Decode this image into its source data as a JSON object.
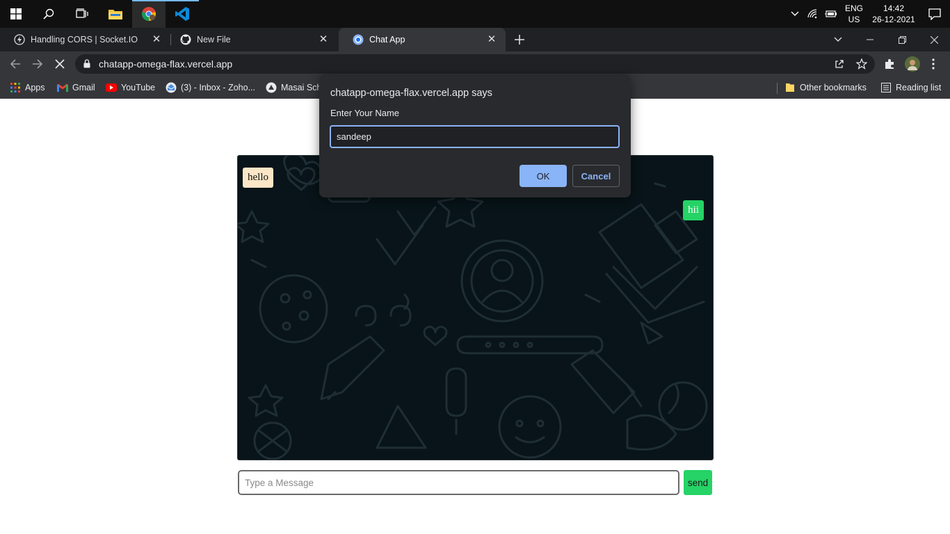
{
  "taskbar": {
    "apps": [
      {
        "name": "start",
        "icon": "windows-icon"
      },
      {
        "name": "search",
        "icon": "search-icon"
      },
      {
        "name": "task-view",
        "icon": "task-view-icon"
      },
      {
        "name": "file-explorer",
        "icon": "folder-icon"
      },
      {
        "name": "chrome",
        "icon": "chrome-icon"
      },
      {
        "name": "vscode",
        "icon": "vscode-icon"
      }
    ],
    "language": {
      "line1": "ENG",
      "line2": "US"
    },
    "clock": {
      "time": "14:42",
      "date": "26-12-2021"
    }
  },
  "tabs": [
    {
      "title": "Handling CORS | Socket.IO",
      "icon": "socketio-icon"
    },
    {
      "title": "New File",
      "icon": "github-icon"
    },
    {
      "title": "Chat App",
      "icon": "chat-app-icon",
      "active": true
    }
  ],
  "toolbar": {
    "url": "chatapp-omega-flax.vercel.app"
  },
  "bookmarks": {
    "items": [
      {
        "label": "Apps",
        "icon": "apps-grid-icon"
      },
      {
        "label": "Gmail",
        "icon": "gmail-icon"
      },
      {
        "label": "YouTube",
        "icon": "youtube-icon"
      },
      {
        "label": "(3) - Inbox - Zoho...",
        "icon": "zoho-icon"
      },
      {
        "label": "Masai Sch",
        "icon": "masai-icon"
      }
    ],
    "other": "Other bookmarks",
    "reading_list": "Reading list"
  },
  "chat": {
    "messages": [
      {
        "text": "hello",
        "side": "left"
      },
      {
        "text": "hii",
        "side": "right"
      }
    ],
    "input_placeholder": "Type a Message",
    "send_label": "send"
  },
  "dialog": {
    "title": "chatapp-omega-flax.vercel.app says",
    "label": "Enter Your Name",
    "value": "sandeep",
    "ok_label": "OK",
    "cancel_label": "Cancel"
  },
  "colors": {
    "accent": "#8ab4f8",
    "send_green": "#25d366",
    "incoming_bubble": "#fbe6c7",
    "chat_bg": "#081419"
  }
}
